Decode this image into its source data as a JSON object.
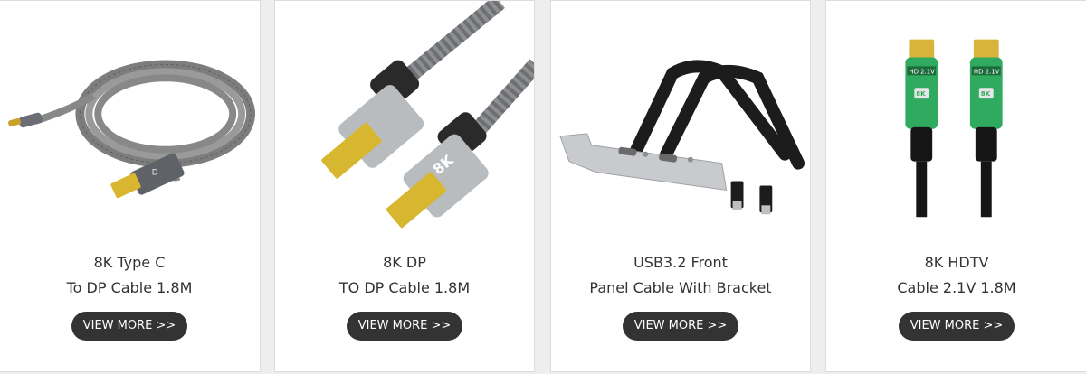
{
  "products": [
    {
      "title_line1": "8K Type C",
      "title_line2": "To DP Cable 1.8M",
      "button_label": "VIEW MORE >>"
    },
    {
      "title_line1": "8K DP",
      "title_line2": "TO DP Cable 1.8M",
      "button_label": "VIEW MORE >>",
      "badge_text": "8K"
    },
    {
      "title_line1": "USB3.2 Front",
      "title_line2": "Panel Cable With Bracket",
      "button_label": "VIEW MORE >>"
    },
    {
      "title_line1": "8K HDTV",
      "title_line2": "Cable 2.1V 1.8M",
      "button_label": "VIEW MORE >>",
      "label_text": "HD 2.1V",
      "badge_text": "8K"
    }
  ],
  "colors": {
    "page_background": "#eeeeee",
    "card_background": "#ffffff",
    "button_background": "#333333",
    "button_text": "#ffffff",
    "title_text": "#333333",
    "hdmi_green": "#2faa5e",
    "cable_gray": "#8a8a8a",
    "gold": "#e2c23a"
  }
}
